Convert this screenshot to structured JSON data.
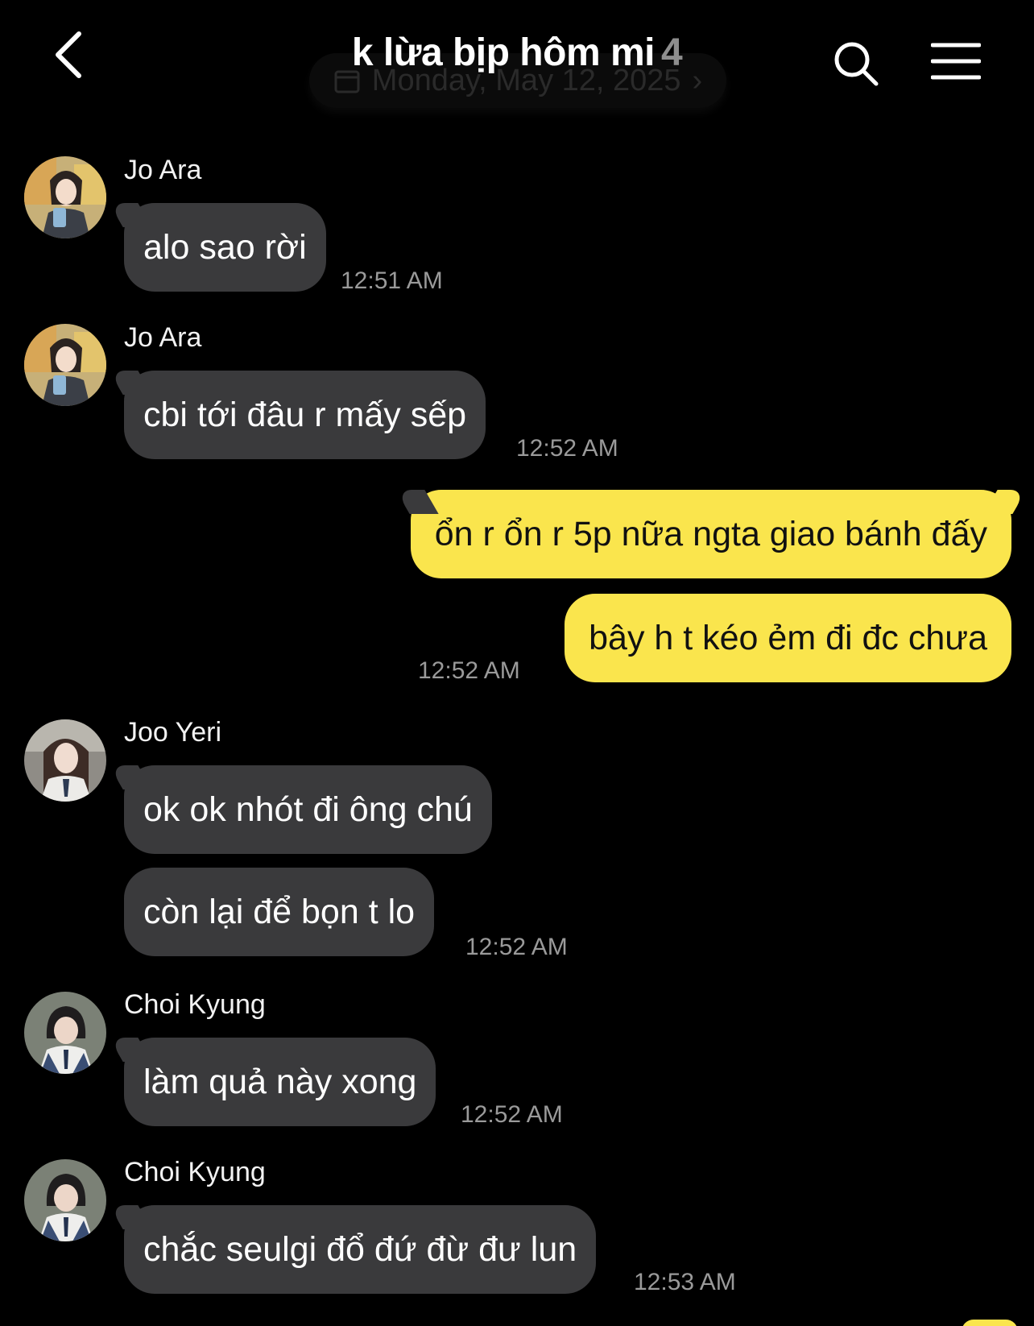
{
  "header": {
    "title": "k lừa bịp hôm mi",
    "member_count": "4",
    "date_label": "Monday, May 12, 2025"
  },
  "messages": [
    {
      "sender": "Jo Ara",
      "text": "alo sao rời",
      "time": "12:51 AM"
    },
    {
      "sender": "Jo Ara",
      "text": "cbi tới đâu r mấy sếp",
      "time": "12:52 AM"
    },
    {
      "sender": "",
      "text": "ổn r ổn r 5p nữa ngta giao bánh đấy",
      "time": ""
    },
    {
      "sender": "",
      "text": "bây h t kéo ẻm đi đc chưa",
      "time": "12:52 AM"
    },
    {
      "sender": "Joo Yeri",
      "text": "ok ok nhót đi ông chú",
      "time": ""
    },
    {
      "sender": "",
      "text": "còn lại để bọn t lo",
      "time": "12:52 AM"
    },
    {
      "sender": "Choi Kyung",
      "text": "làm quả này xong",
      "time": "12:52 AM"
    },
    {
      "sender": "Choi Kyung",
      "text": "chắc seulgi đổ đứ đừ đư lun",
      "time": "12:53 AM"
    }
  ],
  "colors": {
    "background": "#000000",
    "incoming_bubble": "#3a3a3c",
    "outgoing_bubble": "#fae54d",
    "timestamp": "#9a9a9a"
  }
}
